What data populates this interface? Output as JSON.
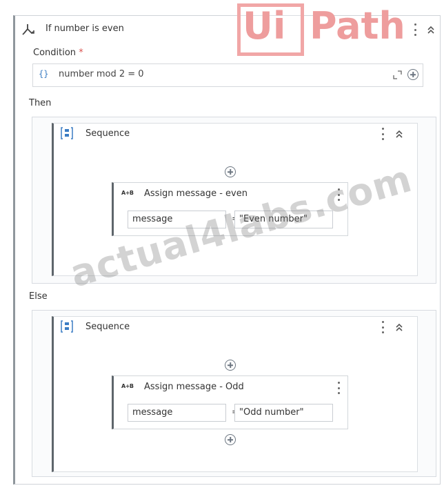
{
  "if_activity": {
    "title": "If number is even",
    "condition_label": "Condition",
    "required_mark": "*",
    "condition_braces": "{}",
    "condition_value": "number mod 2 = 0"
  },
  "then_branch": {
    "label": "Then",
    "sequence_title": "Sequence",
    "assign": {
      "icon_text": "A+B",
      "title": "Assign message - even",
      "to": "message",
      "operator": "=",
      "value": "\"Even number\""
    }
  },
  "else_branch": {
    "label": "Else",
    "sequence_title": "Sequence",
    "assign": {
      "icon_text": "A+B",
      "title": "Assign message - Odd",
      "to": "message",
      "operator": "=",
      "value": "\"Odd number\""
    }
  },
  "watermarks": {
    "logo_ui": "Ui",
    "logo_path": "Path",
    "site": "actual4labs.com"
  },
  "icons": {
    "if": "if-branch-icon",
    "sequence": "sequence-icon",
    "menu": "kebab-menu-icon",
    "collapse": "chevron-double-up-icon",
    "expand": "expand-icon",
    "add": "add-circle-icon"
  },
  "colors": {
    "accent_blue": "#3b7dc4",
    "activity_border": "#5e656b",
    "logo": "#ee9d9d"
  }
}
